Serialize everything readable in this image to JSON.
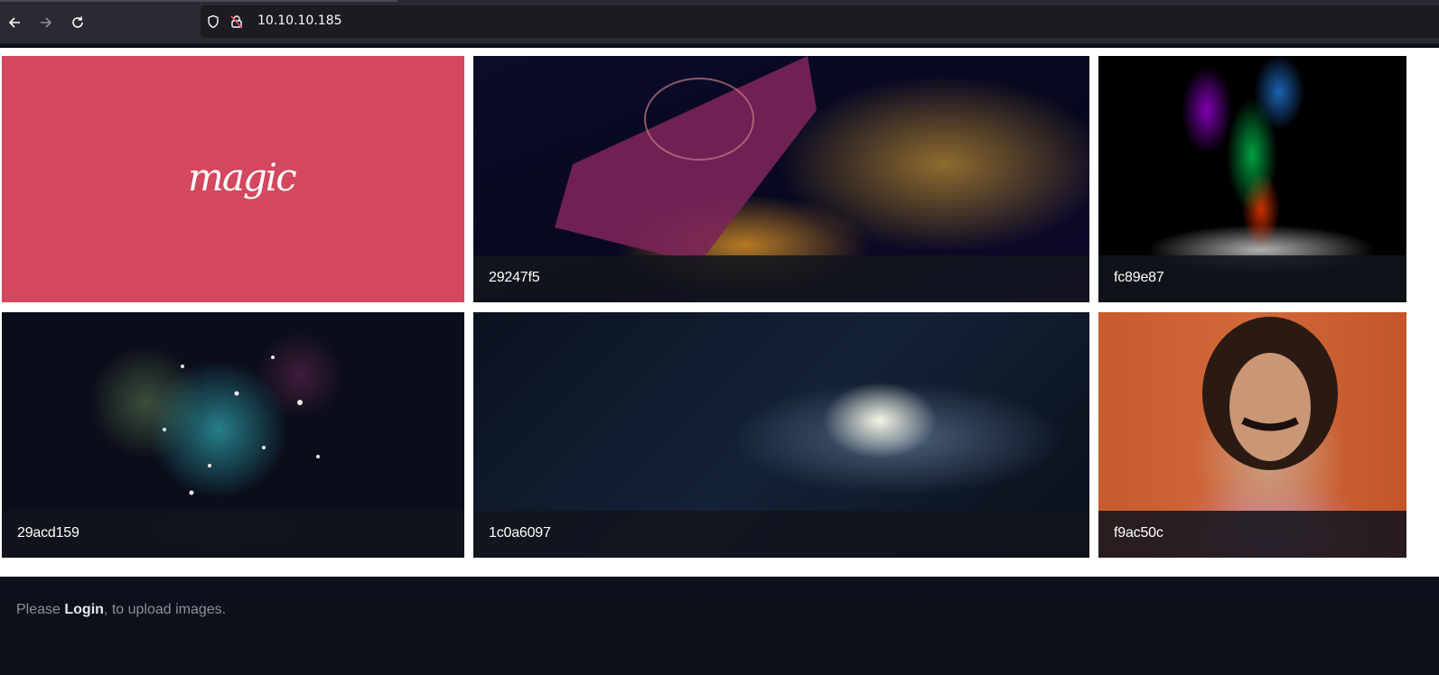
{
  "browser": {
    "url": "10.10.10.185",
    "icons": [
      "back-arrow-icon",
      "forward-arrow-icon",
      "reload-icon",
      "shield-icon",
      "insecure-lock-icon"
    ]
  },
  "gallery": {
    "tiles": [
      {
        "caption": "",
        "art": "magic-logo",
        "logo_text": "magic"
      },
      {
        "caption": "29247f5",
        "art": "glowing-book"
      },
      {
        "caption": "fc89e87",
        "art": "rainbow-smoke-hand"
      },
      {
        "caption": "29acd159",
        "art": "cauldron-sparkles"
      },
      {
        "caption": "1c0a6097",
        "art": "galaxy-hand"
      },
      {
        "caption": "f9ac50c",
        "art": "man-gesture"
      }
    ]
  },
  "footer": {
    "prefix": "Please ",
    "login_label": "Login",
    "suffix": ", to upload images."
  },
  "colors": {
    "magic_tile": "#d3475f",
    "chrome": "#2b2a33",
    "urlbar": "#1c1b22"
  }
}
